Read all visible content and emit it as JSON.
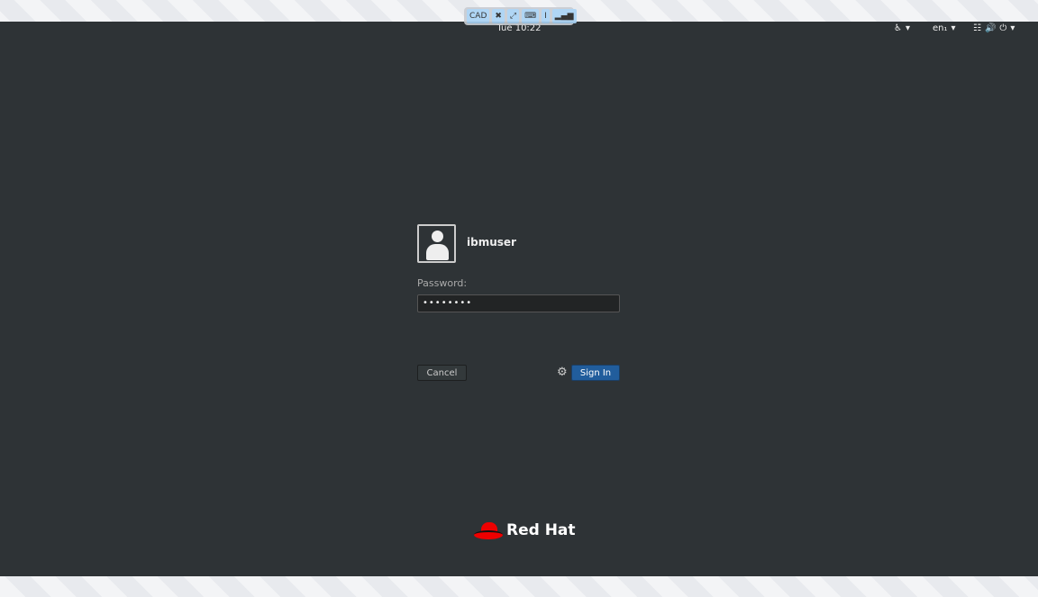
{
  "vnc_toolbar": {
    "items": [
      "CAD",
      "fullscreen-exit-icon",
      "fullscreen-icon",
      "keyboard-icon",
      "text-cursor-icon",
      "signal-icon"
    ],
    "cad_label": "CAD"
  },
  "topbar": {
    "clock": "Tue 10:22",
    "keyboard_layout": "en₁"
  },
  "login": {
    "username": "ibmuser",
    "password_label": "Password:",
    "password_value": "••••••••",
    "cancel_label": "Cancel",
    "signin_label": "Sign In"
  },
  "brand": {
    "logo_text": "Red Hat"
  },
  "colors": {
    "accent": "#215d9c",
    "background": "#2e3336",
    "logo_red": "#ee0000"
  }
}
